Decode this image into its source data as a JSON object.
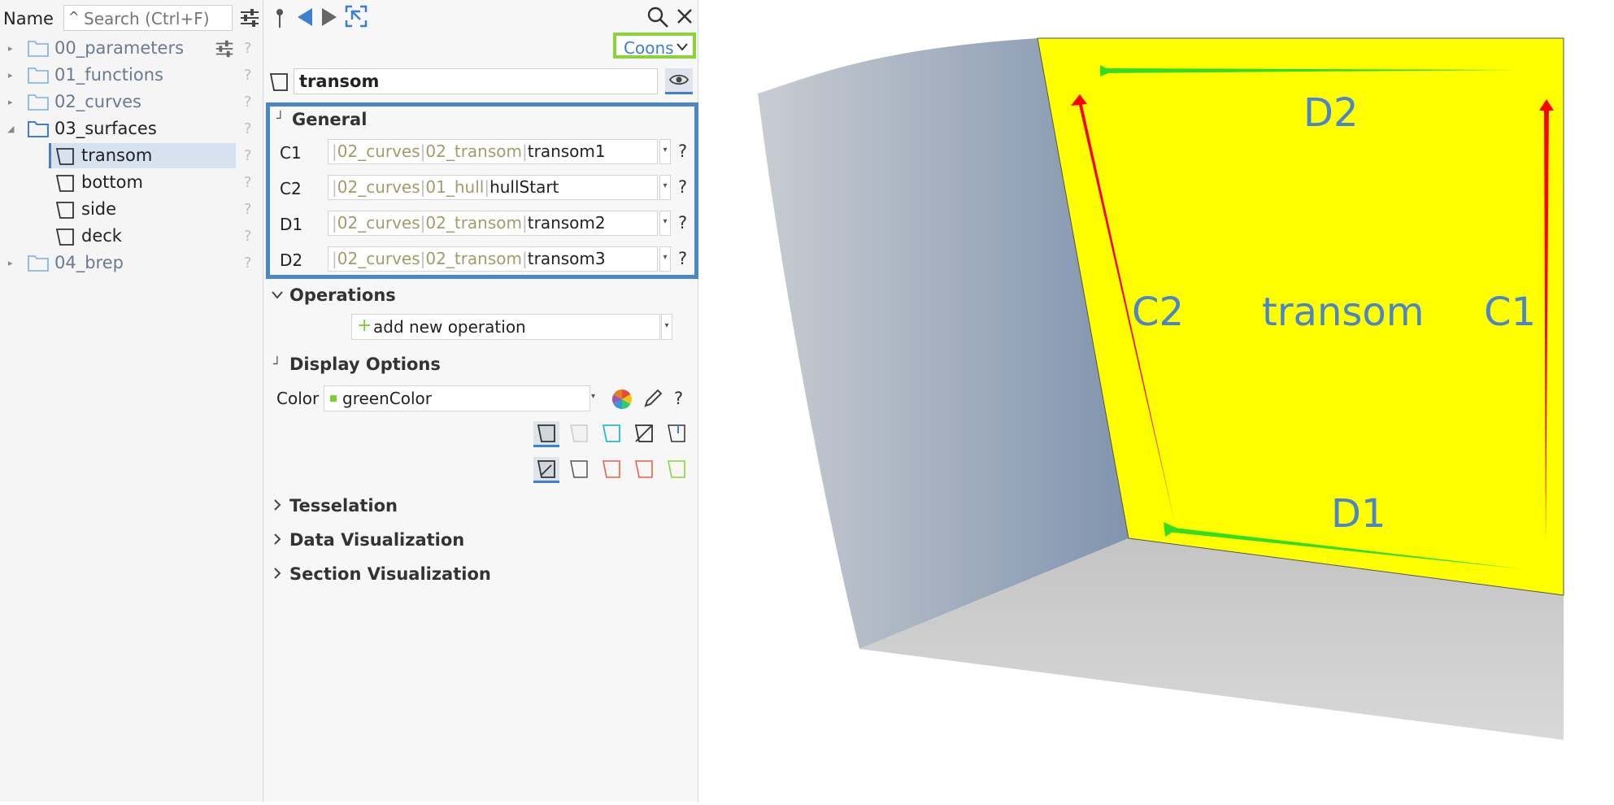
{
  "tree": {
    "header_label": "Name",
    "search_placeholder": "Search (Ctrl+F)",
    "items": [
      {
        "label": "00_parameters",
        "q": "?"
      },
      {
        "label": "01_functions",
        "q": "?"
      },
      {
        "label": "02_curves",
        "q": "?"
      },
      {
        "label": "03_surfaces",
        "q": "?"
      },
      {
        "label": "transom",
        "q": "?"
      },
      {
        "label": "bottom",
        "q": "?"
      },
      {
        "label": "side",
        "q": "?"
      },
      {
        "label": "deck",
        "q": "?"
      },
      {
        "label": "04_brep",
        "q": "?"
      }
    ]
  },
  "properties": {
    "type_selector": "Coons",
    "object_name": "transom",
    "sections": {
      "general": "General",
      "operations": "Operations",
      "display": "Display Options",
      "tesselation": "Tesselation",
      "data_vis": "Data Visualization",
      "section_vis": "Section Visualization"
    },
    "params": [
      {
        "label": "C1",
        "path": [
          "02_curves",
          "02_transom"
        ],
        "leaf": "transom1",
        "q": "?"
      },
      {
        "label": "C2",
        "path": [
          "02_curves",
          "01_hull"
        ],
        "leaf": "hullStart",
        "q": "?"
      },
      {
        "label": "D1",
        "path": [
          "02_curves",
          "02_transom"
        ],
        "leaf": "transom2",
        "q": "?"
      },
      {
        "label": "D2",
        "path": [
          "02_curves",
          "02_transom"
        ],
        "leaf": "transom3",
        "q": "?"
      }
    ],
    "add_operation": "add new operation",
    "color_label": "Color",
    "color_value": "greenColor",
    "color_q": "?"
  },
  "viewport": {
    "labels": {
      "d2": "D2",
      "c2": "C2",
      "center": "transom",
      "c1": "C1",
      "d1": "D1"
    }
  },
  "colors": {
    "accent_blue": "#3d7fd0",
    "highlight_green": "#8ad43a",
    "surface_yellow": "#ffff00",
    "arrow_red": "#ff0000",
    "arrow_green": "#33dd22"
  }
}
